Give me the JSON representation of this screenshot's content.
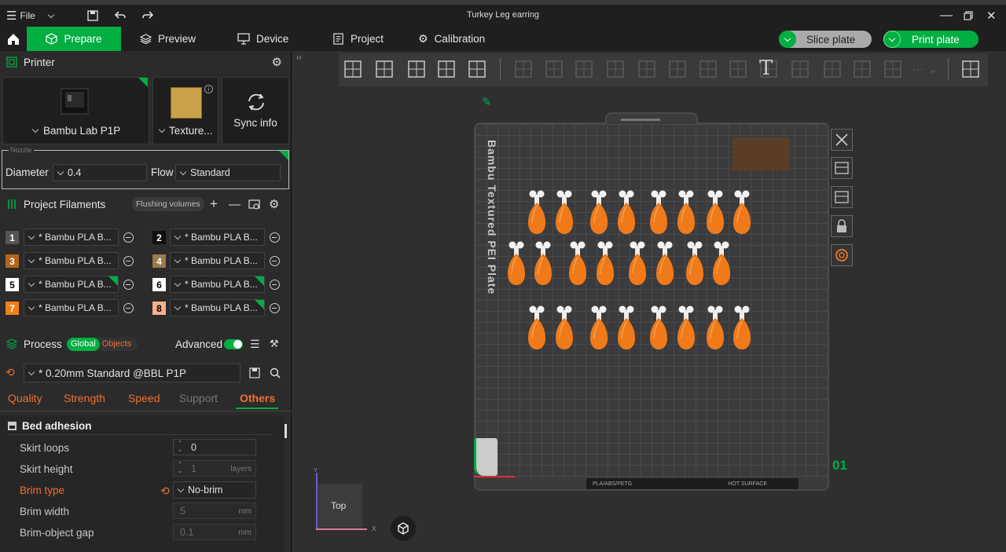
{
  "window": {
    "title": "Turkey Leg earring",
    "file_label": "File"
  },
  "tabs": [
    {
      "label": "Prepare"
    },
    {
      "label": "Preview"
    },
    {
      "label": "Device"
    },
    {
      "label": "Project"
    },
    {
      "label": "Calibration"
    }
  ],
  "actions": {
    "slice": "Slice plate",
    "print": "Print plate"
  },
  "printer": {
    "section": "Printer",
    "model": "Bambu Lab P1P",
    "plate": "Texture...",
    "sync": "Sync info",
    "nozzle_label": "Nozzle",
    "diameter_label": "Diameter",
    "diameter": "0.4",
    "flow_label": "Flow",
    "flow": "Standard"
  },
  "filaments": {
    "section": "Project Filaments",
    "flushing": "Flushing volumes",
    "items": [
      {
        "num": "1",
        "name": "* Bambu PLA B...",
        "color": "#555555"
      },
      {
        "num": "2",
        "name": "* Bambu PLA B...",
        "color": "#101010"
      },
      {
        "num": "3",
        "name": "* Bambu PLA B...",
        "color": "#b5651d"
      },
      {
        "num": "4",
        "name": "* Bambu PLA B...",
        "color": "#9c7a4a"
      },
      {
        "num": "5",
        "name": "* Bambu PLA B...",
        "color": "#ffffff"
      },
      {
        "num": "6",
        "name": "* Bambu PLA B...",
        "color": "#ffffff"
      },
      {
        "num": "7",
        "name": "* Bambu PLA B...",
        "color": "#f07f1a"
      },
      {
        "num": "8",
        "name": "* Bambu PLA B...",
        "color": "#f7b08a"
      }
    ]
  },
  "process": {
    "section": "Process",
    "global": "Global",
    "objects": "Objects",
    "advanced": "Advanced",
    "preset": "* 0.20mm Standard @BBL P1P"
  },
  "subtabs": [
    "Quality",
    "Strength",
    "Speed",
    "Support",
    "Others"
  ],
  "bed": {
    "heading": "Bed adhesion",
    "rows": [
      {
        "label": "Skirt loops",
        "value": "0",
        "unit": ""
      },
      {
        "label": "Skirt height",
        "value": "1",
        "unit": "layers"
      },
      {
        "label": "Brim type",
        "value": "No-brim",
        "unit": ""
      },
      {
        "label": "Brim width",
        "value": "5",
        "unit": "mm"
      },
      {
        "label": "Brim-object gap",
        "value": "0.1",
        "unit": "mm"
      }
    ]
  },
  "viewport": {
    "plate_label": "Bambu Textured PEI Plate",
    "plate_number": "01",
    "view_label": "Top",
    "bottom_strip": "PLA/ABS/PETG",
    "hot_surface": "HOT SURFACE",
    "axis_x": "X",
    "axis_y": "Y"
  }
}
